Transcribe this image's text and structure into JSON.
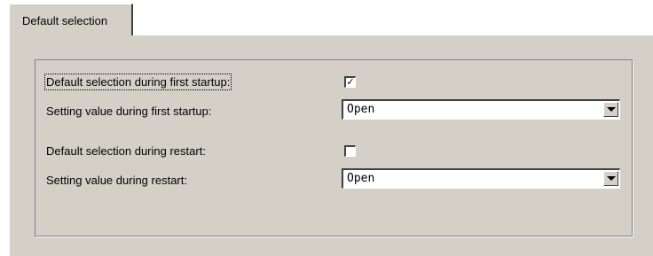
{
  "tab": {
    "label": "Default selection"
  },
  "rows": {
    "first_startup_default": {
      "label": "Default selection during first startup:",
      "checked": true,
      "check_glyph": "✓"
    },
    "first_startup_setting": {
      "label": "Setting value during first startup:",
      "value": "Open"
    },
    "restart_default": {
      "label": "Default selection during restart:",
      "checked": false,
      "check_glyph": ""
    },
    "restart_setting": {
      "label": "Setting value during restart:",
      "value": "Open"
    }
  },
  "icons": {
    "dropdown": "chevron-down-icon",
    "checkmark": "checkmark-icon"
  }
}
